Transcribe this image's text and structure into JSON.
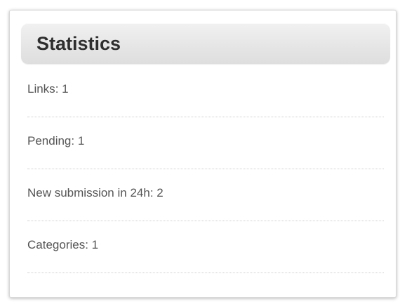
{
  "widget": {
    "title": "Statistics",
    "stats": [
      {
        "label": "Links",
        "value": "1"
      },
      {
        "label": "Pending",
        "value": "1"
      },
      {
        "label": "New submission in 24h",
        "value": "2"
      },
      {
        "label": "Categories",
        "value": "1"
      }
    ]
  },
  "colors": {
    "title_text": "#2e2e2e",
    "body_text": "#555555",
    "header_bg": "#e6e6e6",
    "divider": "#cfcfcf"
  }
}
